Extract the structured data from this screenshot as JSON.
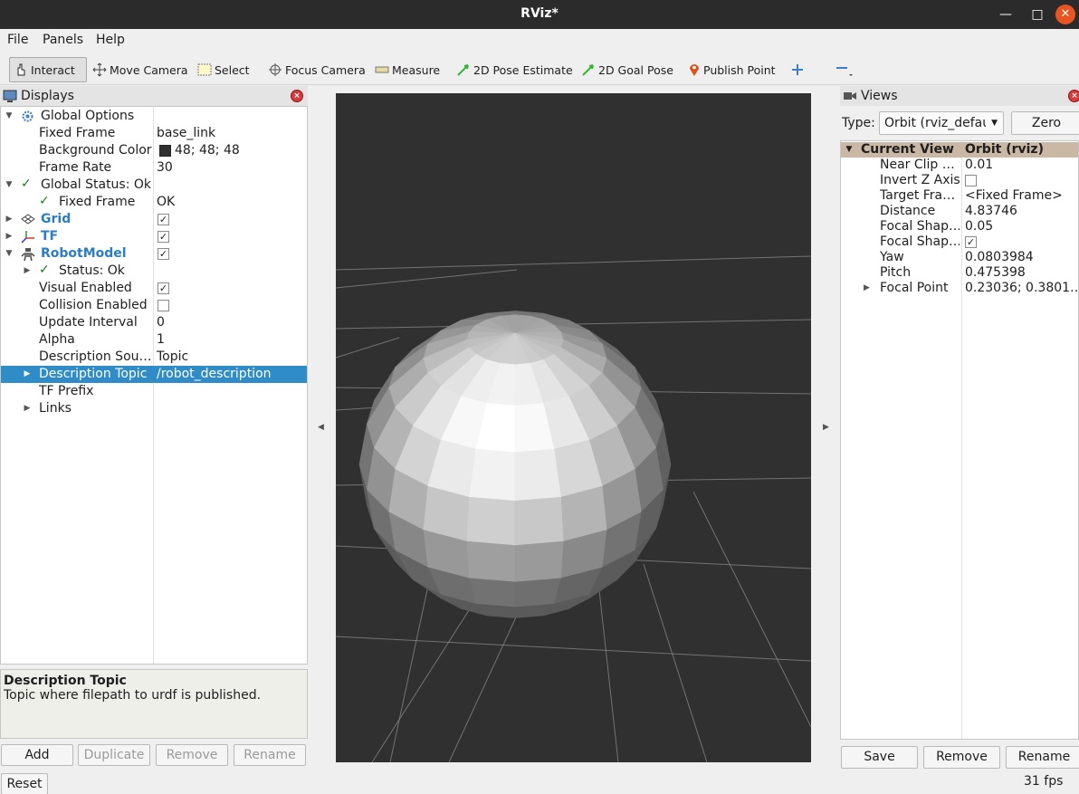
{
  "window": {
    "title": "RViz*"
  },
  "menu": {
    "file": "File",
    "panels": "Panels",
    "help": "Help"
  },
  "toolbar": {
    "interact": "Interact",
    "move_camera": "Move Camera",
    "select": "Select",
    "focus_camera": "Focus Camera",
    "measure": "Measure",
    "pose_estimate": "2D Pose Estimate",
    "goal_pose": "2D Goal Pose",
    "publish_point": "Publish Point"
  },
  "displays": {
    "title": "Displays",
    "rows": [
      {
        "label": "Global Options",
        "value": ""
      },
      {
        "label": "Fixed Frame",
        "value": "base_link"
      },
      {
        "label": "Background Color",
        "value": "48; 48; 48"
      },
      {
        "label": "Frame Rate",
        "value": "30"
      },
      {
        "label": "Global Status: Ok",
        "value": ""
      },
      {
        "label": "Fixed Frame",
        "value": "OK"
      },
      {
        "label": "Grid",
        "value": ""
      },
      {
        "label": "TF",
        "value": ""
      },
      {
        "label": "RobotModel",
        "value": ""
      },
      {
        "label": "Status: Ok",
        "value": ""
      },
      {
        "label": "Visual Enabled",
        "value": ""
      },
      {
        "label": "Collision Enabled",
        "value": ""
      },
      {
        "label": "Update Interval",
        "value": "0"
      },
      {
        "label": "Alpha",
        "value": "1"
      },
      {
        "label": "Description Sou…",
        "value": "Topic"
      },
      {
        "label": "Description Topic",
        "value": "/robot_description"
      },
      {
        "label": "TF Prefix",
        "value": ""
      },
      {
        "label": "Links",
        "value": ""
      }
    ],
    "checks": {
      "grid": true,
      "tf": true,
      "robot_model": true,
      "visual_enabled": true,
      "collision_enabled": false
    },
    "background_color": "#303030"
  },
  "description": {
    "title": "Description Topic",
    "text": "Topic where filepath to urdf is published."
  },
  "display_buttons": {
    "add": "Add",
    "duplicate": "Duplicate",
    "remove": "Remove",
    "rename": "Rename"
  },
  "reset": "Reset",
  "views": {
    "title": "Views",
    "type_label": "Type:",
    "type_value": "Orbit (rviz_default_plugins)",
    "zero": "Zero",
    "header_label": "Current View",
    "header_value": "Orbit (rviz)",
    "rows": [
      {
        "label": "Near Clip …",
        "value": "0.01"
      },
      {
        "label": "Invert Z Axis",
        "value": ""
      },
      {
        "label": "Target Fra…",
        "value": "<Fixed Frame>"
      },
      {
        "label": "Distance",
        "value": "4.83746"
      },
      {
        "label": "Focal Shap…",
        "value": "0.05"
      },
      {
        "label": "Focal Shap…",
        "value": ""
      },
      {
        "label": "Yaw",
        "value": "0.0803984"
      },
      {
        "label": "Pitch",
        "value": "0.475398"
      },
      {
        "label": "Focal Point",
        "value": "0.23036; 0.3801…"
      }
    ],
    "checks": {
      "invert_z": false,
      "focal_shape_fixed": true
    },
    "buttons": {
      "save": "Save",
      "remove": "Remove",
      "rename": "Rename"
    }
  },
  "status": {
    "fps": "31 fps"
  },
  "colors": {
    "viewport_bg": "#303030",
    "selection": "#308cc6",
    "accent_blue": "#2a7dc9"
  }
}
